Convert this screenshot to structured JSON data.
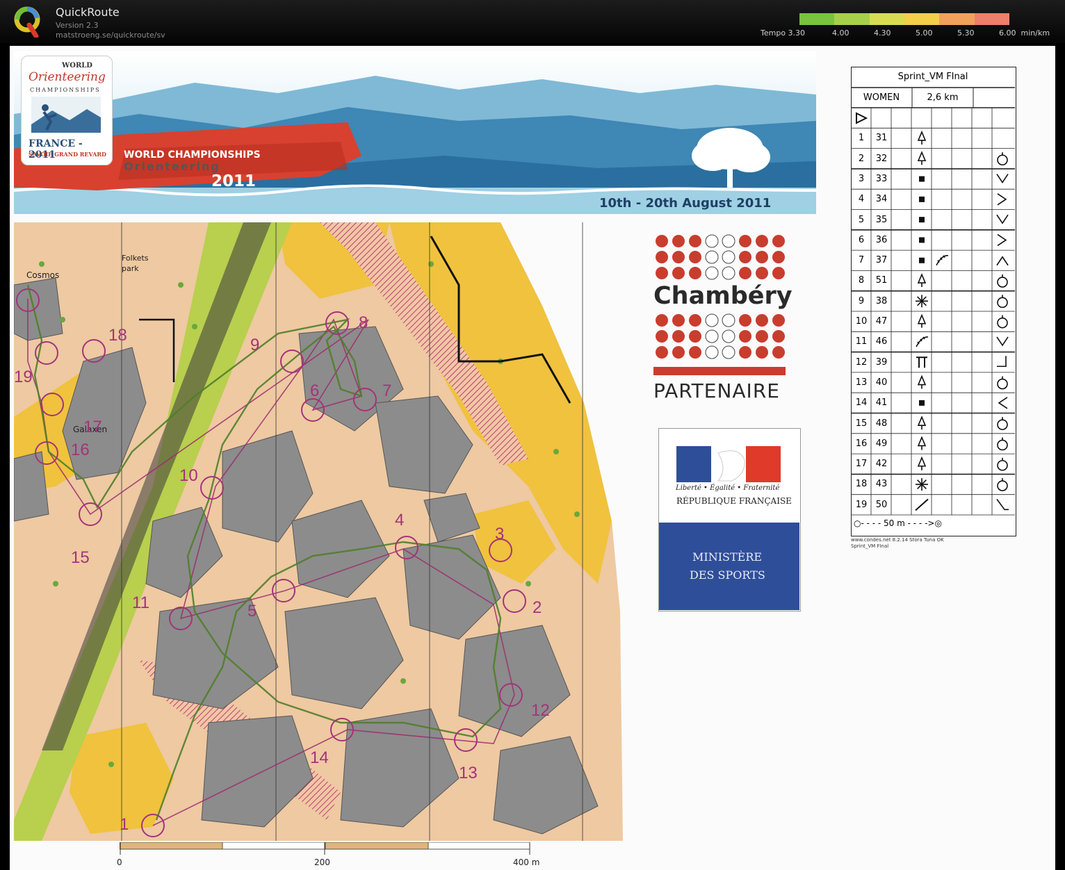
{
  "app": {
    "name": "QuickRoute",
    "version": "Version 2.3",
    "url": "matstroeng.se/quickroute/sv"
  },
  "tempo": {
    "label": "Tempo",
    "ticks": [
      "3.30",
      "4.00",
      "4.30",
      "5.00",
      "5.30",
      "6.00"
    ],
    "unit": "min/km",
    "colors": [
      "#79c33f",
      "#a7d04a",
      "#d7dc52",
      "#f3cf4a",
      "#f1a15c",
      "#ee7f6a"
    ]
  },
  "banner": {
    "woc_world": "WORLD",
    "woc_orienteering": "Orienteering",
    "woc_championships": "CHAMPIONSHIPS",
    "woc_france": "FRANCE - 2011",
    "woc_savoie": "SAVOIE GRAND REVARD",
    "sash_world": "WORLD CHAMPIONSHIPS",
    "sash_orienteering": "Orienteering",
    "sash_year": "2011",
    "dates": "10th - 20th August 2011"
  },
  "map": {
    "labels": {
      "cosmos": "Cosmos",
      "folkets": "Folkets",
      "park": "park",
      "galaxen": "Galaxen"
    },
    "controls": [
      "1",
      "2",
      "3",
      "4",
      "5",
      "6",
      "7",
      "8",
      "9",
      "10",
      "11",
      "12",
      "13",
      "14",
      "15",
      "16",
      "17",
      "18",
      "19"
    ]
  },
  "scale": {
    "l0": "0",
    "l1": "200",
    "l2": "400 m"
  },
  "chambery": {
    "word": "Chambéry",
    "partner": "PARTENAIRE",
    "accent": "#c83d2e"
  },
  "republique": {
    "motto": "Liberté • Égalité • Fraternité",
    "name": "RÉPUBLIQUE FRANÇAISE",
    "ministry_1": "MINISTÈRE",
    "ministry_2": "DES SPORTS",
    "blue": "#2f4e9a"
  },
  "description": {
    "title": "Sprint_VM FInal",
    "class": "WOMEN",
    "length": "2,6 km",
    "start_symbol": "triangle-start-icon",
    "rows": [
      {
        "n": "1",
        "code": "31",
        "feature": "tree",
        "detail": ""
      },
      {
        "n": "2",
        "code": "32",
        "feature": "tree",
        "detail": "circle-north"
      },
      {
        "n": "3",
        "code": "33",
        "feature": "square",
        "detail": "corner-south"
      },
      {
        "n": "4",
        "code": "34",
        "feature": "square",
        "detail": "corner-east"
      },
      {
        "n": "5",
        "code": "35",
        "feature": "square",
        "detail": "corner-south"
      },
      {
        "n": "6",
        "code": "36",
        "feature": "square",
        "detail": "corner-east"
      },
      {
        "n": "7",
        "code": "37",
        "feature": "square",
        "detail": "corner-north"
      },
      {
        "n": "8",
        "code": "51",
        "feature": "tree",
        "detail": "circle"
      },
      {
        "n": "9",
        "code": "38",
        "feature": "thicket",
        "detail": "circle"
      },
      {
        "n": "10",
        "code": "47",
        "feature": "tree",
        "detail": "circle"
      },
      {
        "n": "11",
        "code": "46",
        "feature": "wall",
        "detail": "corner-south"
      },
      {
        "n": "12",
        "code": "39",
        "feature": "gate",
        "detail": "end"
      },
      {
        "n": "13",
        "code": "40",
        "feature": "tree",
        "detail": "circle"
      },
      {
        "n": "14",
        "code": "41",
        "feature": "square",
        "detail": "corner-west"
      },
      {
        "n": "15",
        "code": "48",
        "feature": "tree",
        "detail": "circle"
      },
      {
        "n": "16",
        "code": "49",
        "feature": "tree",
        "detail": "circle"
      },
      {
        "n": "17",
        "code": "42",
        "feature": "tree",
        "detail": "circle"
      },
      {
        "n": "18",
        "code": "43",
        "feature": "thicket",
        "detail": "circle"
      },
      {
        "n": "19",
        "code": "50",
        "feature": "line",
        "detail": "corner-southeast"
      }
    ],
    "finish": "○- - - - 50 m - - - ->◎",
    "credit_1": "www.condes.net 8.2.14 Stora Tuna OK",
    "credit_2": "Sprint_VM FInal"
  }
}
